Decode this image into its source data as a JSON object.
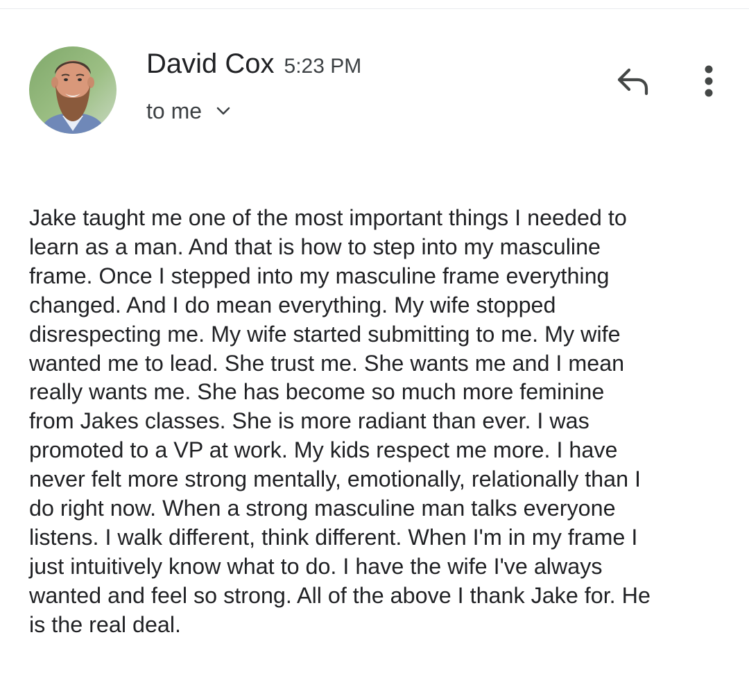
{
  "email": {
    "sender_name": "David Cox",
    "sent_time": "5:23 PM",
    "recipient": "to me",
    "body": "Jake taught me one of the most important things I needed to\nlearn as a man. And that is how to step into my masculine\nframe. Once I stepped into my masculine frame everything\nchanged. And I do mean everything. My wife stopped\ndisrespecting me. My wife started submitting to me. My wife\nwanted me to lead. She trust me. She wants me and I mean\nreally wants me. She has become so much more feminine\nfrom Jakes classes. She is more radiant than ever. I was\npromoted to a VP at work. My kids respect me more. I have\nnever felt more strong mentally, emotionally, relationally than I\ndo right now. When a strong masculine man talks everyone\nlistens. I walk different, think different. When I'm in my frame I\njust intuitively know what to do. I have the wife I've always\nwanted and feel so strong. All of the above I thank Jake for. He\nis the real deal."
  },
  "icons": {
    "reply": "reply-icon",
    "more": "more-vert-icon",
    "expand": "chevron-down-icon",
    "avatar": "sender-avatar"
  },
  "colors": {
    "text_primary": "#202124",
    "text_secondary": "#3c4043",
    "icon": "#444746",
    "background": "#ffffff"
  }
}
